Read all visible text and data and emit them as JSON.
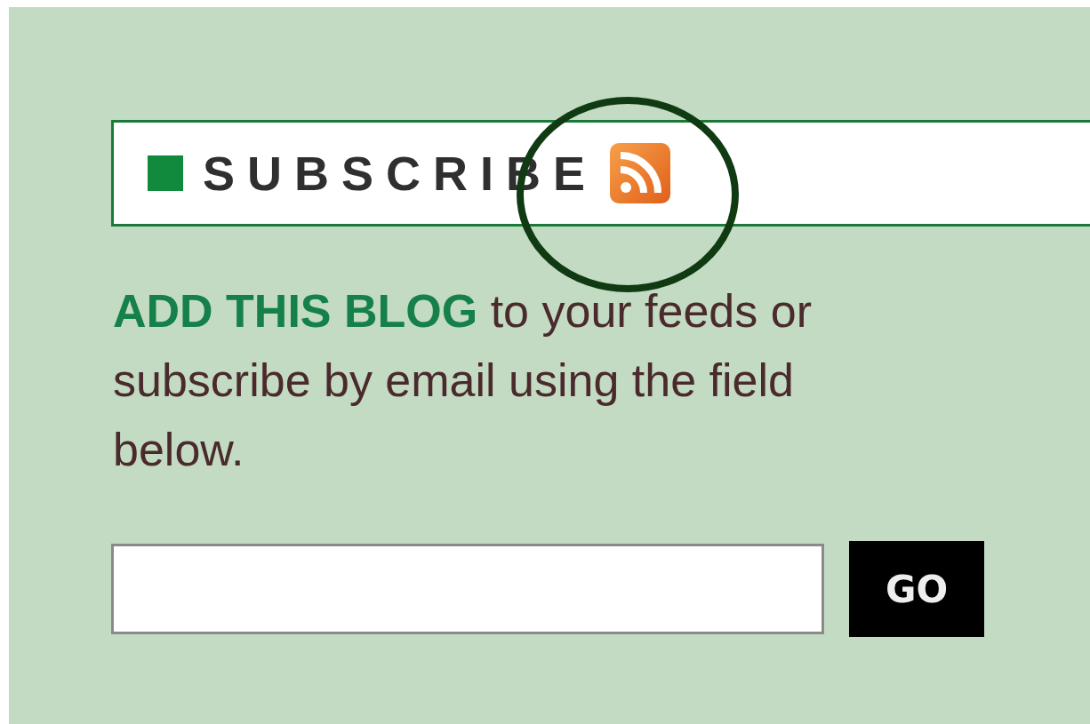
{
  "subscribe_header": {
    "title": "SUBSCRIBE"
  },
  "intro": "**ADD THIS BLOG** to your feeds or subscribe by email using the field below.",
  "go_button": {
    "label": "GO"
  }
}
